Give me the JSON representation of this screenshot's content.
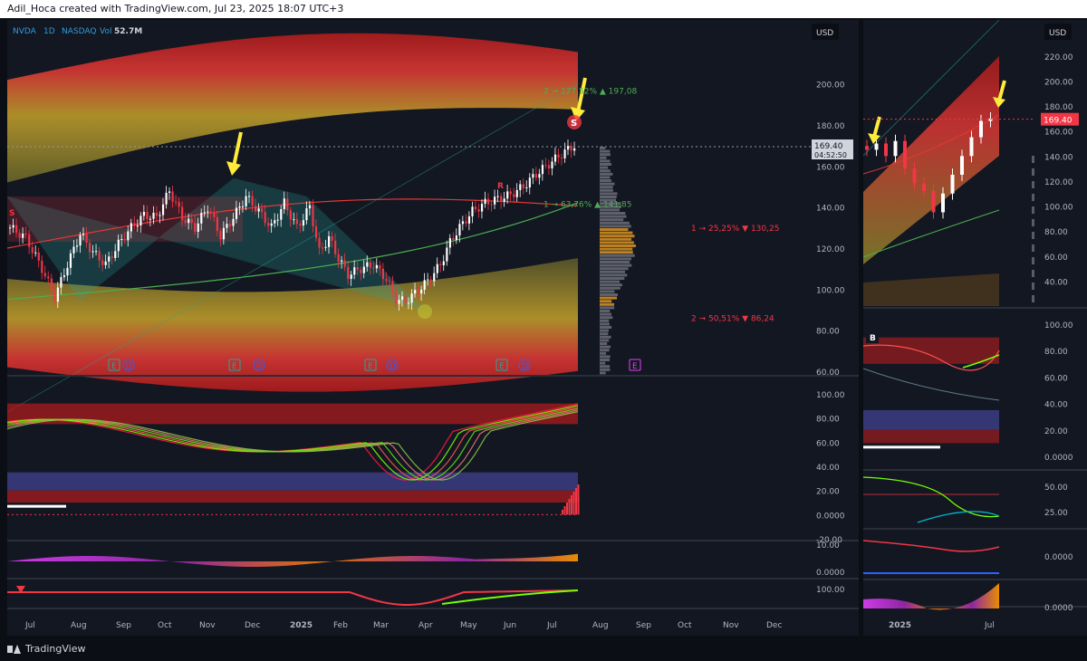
{
  "header": {
    "credit": "Adil_Hoca created with TradingView.com, Jul 23, 2025 18:07 UTC+3"
  },
  "footer": {
    "brand": "TradingView"
  },
  "colors": {
    "bg": "#131722",
    "up": "#ffffff",
    "down": "#f23645",
    "accent_green": "#4caf50",
    "yellow": "#ffeb3b",
    "price_tag": "#f23645"
  },
  "chart_data": [
    {
      "id": "main",
      "type": "candlestick",
      "legend": {
        "symbol": "NVDA",
        "interval": "1D",
        "exchange": "NASDAQ",
        "vol_label": "Vol",
        "vol_value": "52.7M"
      },
      "currency": "USD",
      "ylim": [
        60,
        210
      ],
      "y_ticks": [
        "200.00",
        "180.00",
        "160.00",
        "140.00",
        "120.00",
        "100.00",
        "80.00",
        "60.00"
      ],
      "x_ticks": [
        "Jul",
        "Aug",
        "Sep",
        "Oct",
        "Nov",
        "Dec",
        "2025",
        "Feb",
        "Mar",
        "Apr",
        "May",
        "Jun",
        "Jul",
        "Aug",
        "Sep",
        "Oct",
        "Nov",
        "Dec"
      ],
      "last_price": "169.40",
      "countdown": "04:52:50",
      "price_path": [
        [
          0,
          130
        ],
        [
          5,
          125
        ],
        [
          10,
          110
        ],
        [
          14,
          96
        ],
        [
          18,
          112
        ],
        [
          22,
          127
        ],
        [
          26,
          118
        ],
        [
          30,
          112
        ],
        [
          34,
          122
        ],
        [
          38,
          130
        ],
        [
          42,
          136
        ],
        [
          46,
          135
        ],
        [
          50,
          148
        ],
        [
          54,
          135
        ],
        [
          58,
          130
        ],
        [
          62,
          140
        ],
        [
          66,
          126
        ],
        [
          70,
          135
        ],
        [
          74,
          145
        ],
        [
          78,
          138
        ],
        [
          82,
          130
        ],
        [
          86,
          142
        ],
        [
          90,
          130
        ],
        [
          94,
          140
        ],
        [
          97,
          118
        ],
        [
          100,
          125
        ],
        [
          103,
          115
        ],
        [
          106,
          107
        ],
        [
          110,
          110
        ],
        [
          114,
          112
        ],
        [
          118,
          105
        ],
        [
          121,
          95
        ],
        [
          124,
          94
        ],
        [
          127,
          98
        ],
        [
          131,
          104
        ],
        [
          135,
          112
        ],
        [
          138,
          123
        ],
        [
          141,
          130
        ],
        [
          145,
          138
        ],
        [
          149,
          142
        ],
        [
          153,
          144
        ],
        [
          157,
          146
        ],
        [
          161,
          150
        ],
        [
          165,
          156
        ],
        [
          169,
          161
        ],
        [
          174,
          167
        ],
        [
          177,
          170
        ],
        [
          178,
          169.4
        ]
      ],
      "fib_targets": [
        {
          "label": "2 → 127,52% ▲ 197,08",
          "price": 197.08,
          "color": "#4caf50"
        },
        {
          "label": "1 → 63,76% ▲ 141,85",
          "price": 141.85,
          "color": "#4caf50"
        },
        {
          "label": "1 → 25,25% ▼ 130,25",
          "price": 130.25,
          "color": "#f23645"
        },
        {
          "label": "2 → 50,51% ▼ 86,24",
          "price": 86.24,
          "color": "#f23645"
        }
      ],
      "markers": [
        "S",
        "R",
        "S"
      ],
      "event_badges": [
        "E",
        "D",
        "E",
        "D",
        "E",
        "D",
        "E",
        "D",
        "E"
      ]
    },
    {
      "id": "oscillator_1",
      "type": "line",
      "ylim": [
        -20,
        100
      ],
      "y_ticks": [
        "100.00",
        "80.00",
        "60.00",
        "40.00",
        "20.00",
        "0.0000",
        "-20.00"
      ]
    },
    {
      "id": "oscillator_2",
      "type": "area",
      "y_ticks": [
        "10.00",
        "0.0000"
      ]
    },
    {
      "id": "oscillator_3",
      "type": "line",
      "y_ticks": [
        "100.00"
      ]
    },
    {
      "id": "right_weekly",
      "type": "candlestick",
      "currency": "USD",
      "ylim": [
        20,
        230
      ],
      "y_ticks": [
        "220.00",
        "200.00",
        "180.00",
        "160.00",
        "140.00",
        "120.00",
        "100.00",
        "80.00",
        "60.00",
        "40.00"
      ],
      "last_price": "169.40",
      "x_ticks": [
        "2025",
        "Jul"
      ],
      "right_osc1_ticks": [
        "100.00",
        "80.00",
        "60.00",
        "40.00",
        "20.00",
        "0.0000"
      ],
      "right_osc2_ticks": [
        "50.00",
        "25.00"
      ],
      "right_osc3_ticks": [
        "0.0000"
      ],
      "right_osc4_ticks": [
        "0.0000"
      ],
      "badge": "B"
    }
  ]
}
